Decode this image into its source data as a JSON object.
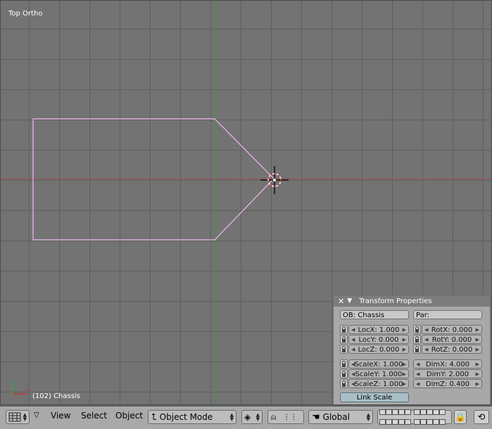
{
  "viewport": {
    "view_label": "Top Ortho",
    "object_label": "(102) Chassis"
  },
  "panel": {
    "title": "Transform Properties",
    "close_glyph": "✕",
    "collapse_glyph": "▼",
    "ob_field": "OB: Chassis",
    "par_field": "Par:",
    "loc": [
      {
        "label": "LocX: 1.000"
      },
      {
        "label": "LocY: 0.000"
      },
      {
        "label": "LocZ: 0.000"
      }
    ],
    "rot": [
      {
        "label": "RotX: 0.000"
      },
      {
        "label": "RotY: 0.000"
      },
      {
        "label": "RotZ: 0.000"
      }
    ],
    "scale": [
      {
        "label": "ScaleX: 1.000"
      },
      {
        "label": "ScaleY: 1.000"
      },
      {
        "label": "ScaleZ: 1.000"
      }
    ],
    "dim": [
      {
        "label": "DimX: 4.000"
      },
      {
        "label": "DimY: 2.000"
      },
      {
        "label": "DimZ: 0.400"
      }
    ],
    "link_scale": "Link Scale"
  },
  "header": {
    "view": "View",
    "select": "Select",
    "object": "Object",
    "mode": "Object Mode",
    "orientation": "Global"
  },
  "colors": {
    "selection_outline": "#f0b8f0",
    "x_axis": "#a04848",
    "y_axis": "#3d9a3d",
    "link_scale_bg": "#a9bfc8"
  }
}
